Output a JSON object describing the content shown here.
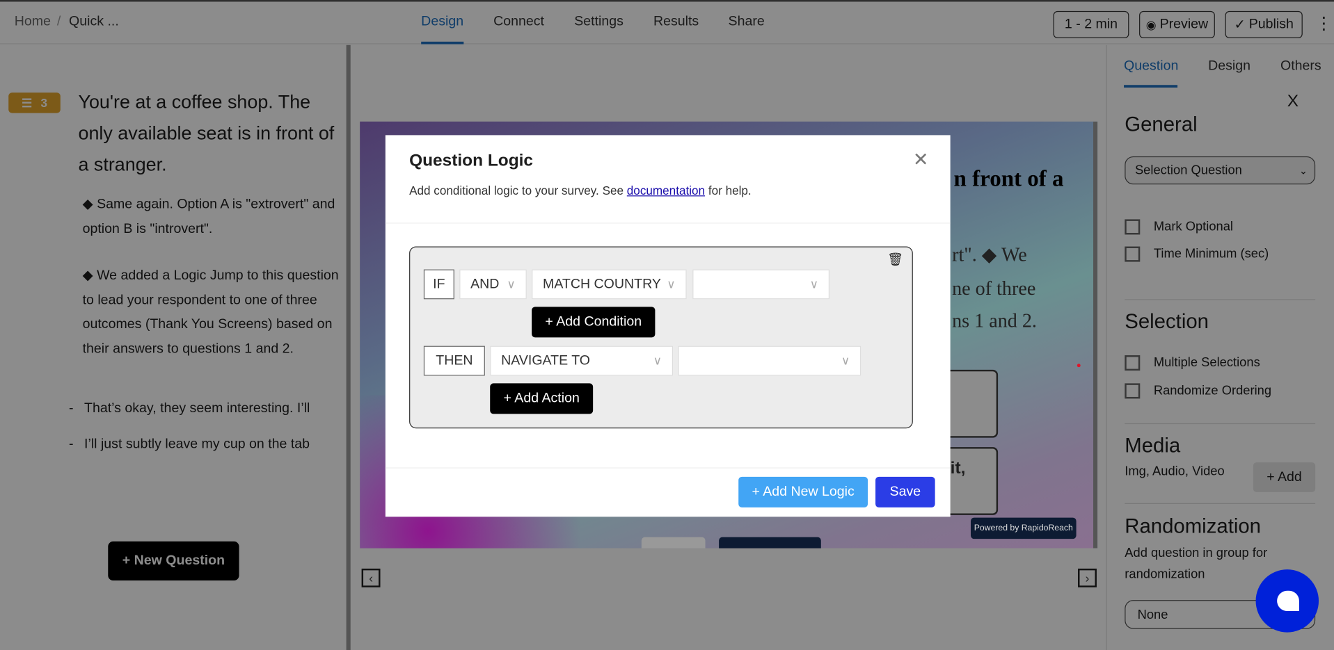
{
  "header": {
    "breadcrumb": [
      "Home",
      "/",
      "Quick ..."
    ],
    "tabs": [
      "Design",
      "Connect",
      "Settings",
      "Results",
      "Share"
    ],
    "active_tab": "Design",
    "duration_label": "1 - 2 min",
    "preview_label": "Preview",
    "publish_label": "Publish",
    "more_icon": "⋮"
  },
  "left": {
    "badge_number": "3",
    "question": "You're at a coffee shop. The only available seat is in front of a stranger.",
    "desc1": "◆ Same again. Option A is \"extrovert\" and option B is \"introvert\".",
    "desc2": "◆ We added a Logic Jump to this question to lead your respondent to one of three outcomes (Thank You Screens) based on their answers to questions 1 and 2.",
    "options": [
      "That’s okay, they seem interesting. I’ll",
      "I’ll just subtly leave my cup on the tab"
    ],
    "new_question_label": "+ New Question"
  },
  "preview": {
    "title_fragment": "n front of a",
    "desc_fragments": [
      "rt\". ◆ We",
      "ne of three",
      "ns 1 and 2."
    ],
    "option_fragment": "it,",
    "powered_by": "Powered by RapidoReach"
  },
  "right": {
    "tabs": [
      "Question",
      "Design",
      "Others"
    ],
    "active_tab": "Question",
    "close_label": "X",
    "general_title": "General",
    "question_type": "Selection Question",
    "mark_optional": "Mark Optional",
    "time_minimum": "Time Minimum (sec)",
    "selection_title": "Selection",
    "multiple_selections": "Multiple Selections",
    "randomize_ordering": "Randomize Ordering",
    "media_title": "Media",
    "media_desc": "Img, Audio, Video",
    "add_label": "+ Add",
    "randomization_title": "Randomization",
    "randomization_desc": "Add question in group for randomization",
    "group_value": "None"
  },
  "modal": {
    "title": "Question Logic",
    "subtitle_prefix": "Add conditional logic to your survey. See ",
    "link_text": "documentation",
    "subtitle_suffix": " for help.",
    "if_label": "IF",
    "operator": "AND",
    "condition": "MATCH COUNTRY",
    "condition_value": "",
    "add_condition": "+ Add Condition",
    "then_label": "THEN",
    "action": "NAVIGATE TO",
    "action_value": "",
    "add_action": "+ Add Action",
    "add_new_logic": "+ Add New Logic",
    "save": "Save",
    "colors": {
      "add_new_logic": "#42a5f5",
      "save": "#2b3de6",
      "link": "#1a0dab"
    }
  }
}
